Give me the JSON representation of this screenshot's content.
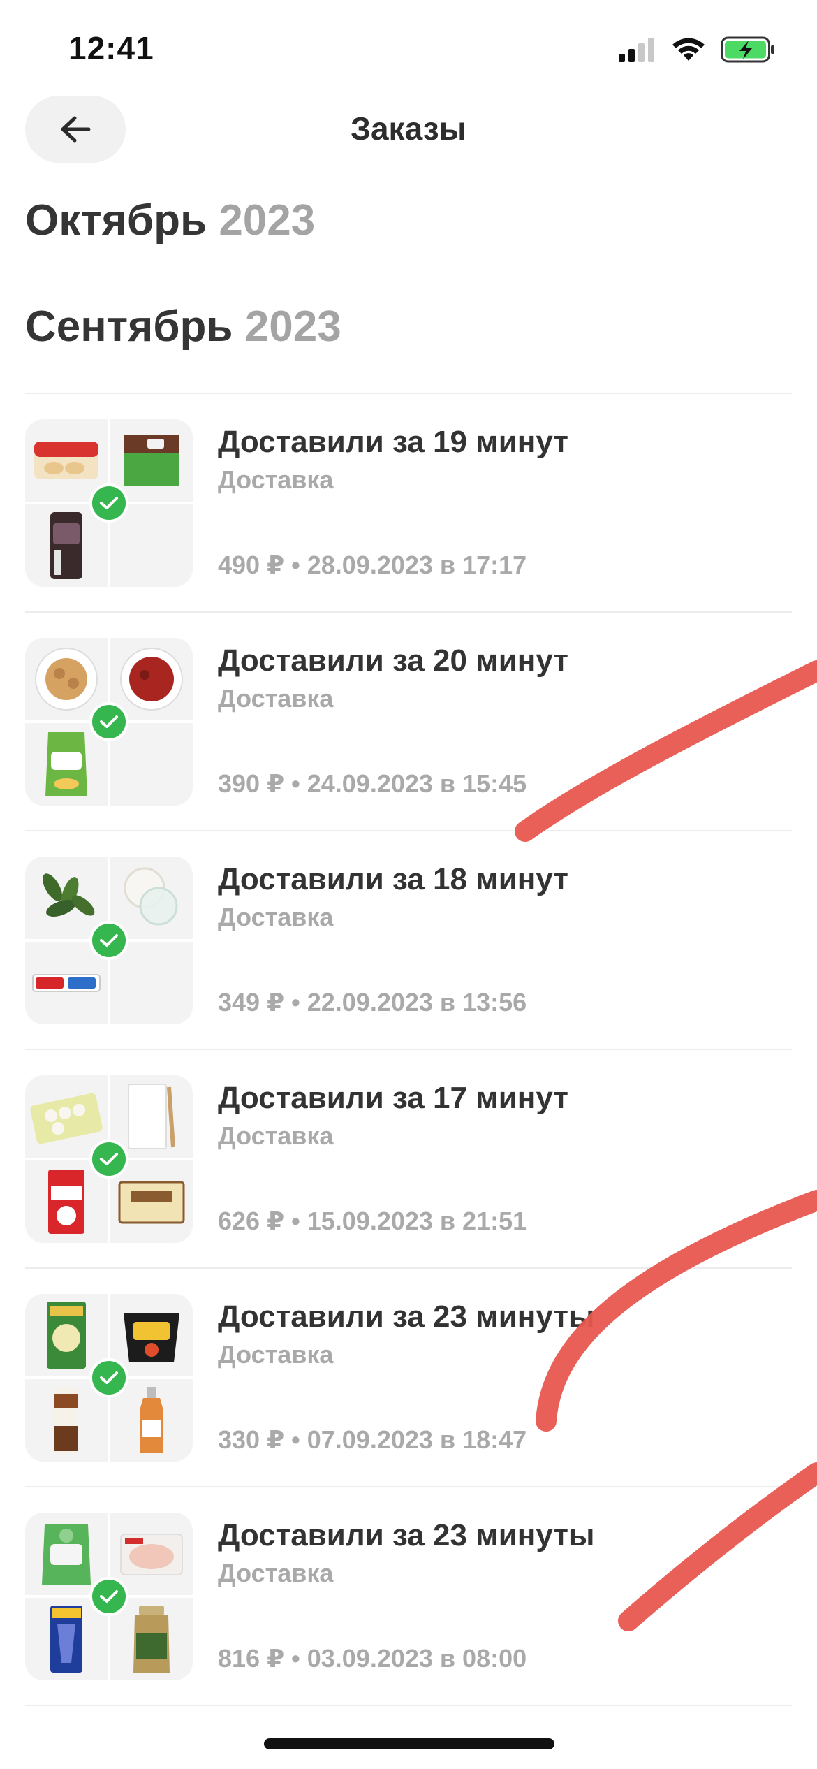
{
  "status_bar": {
    "time": "12:41"
  },
  "header": {
    "title": "Заказы"
  },
  "months": [
    {
      "name": "Октябрь",
      "year": "2023"
    },
    {
      "name": "Сентябрь",
      "year": "2023"
    }
  ],
  "orders": [
    {
      "title": "Доставили за 19 минут",
      "type": "Доставка",
      "price": "490 ₽",
      "date": "28.09.2023 в 17:17",
      "separator": "•"
    },
    {
      "title": "Доставили за 20 минут",
      "type": "Доставка",
      "price": "390 ₽",
      "date": "24.09.2023 в 15:45",
      "separator": "•"
    },
    {
      "title": "Доставили за 18 минут",
      "type": "Доставка",
      "price": "349 ₽",
      "date": "22.09.2023 в 13:56",
      "separator": "•"
    },
    {
      "title": "Доставили за 17 минут",
      "type": "Доставка",
      "price": "626 ₽",
      "date": "15.09.2023 в 21:51",
      "separator": "•"
    },
    {
      "title": "Доставили за 23 минуты",
      "type": "Доставка",
      "price": "330 ₽",
      "date": "07.09.2023 в 18:47",
      "separator": "•"
    },
    {
      "title": "Доставили за 23 минуты",
      "type": "Доставка",
      "price": "816 ₽",
      "date": "03.09.2023 в 08:00",
      "separator": "•"
    }
  ],
  "icons": {
    "back": "arrow-left-icon",
    "check": "check-icon",
    "signal": "cellular-signal-icon",
    "wifi": "wifi-icon",
    "battery": "battery-charging-icon"
  },
  "colors": {
    "check_green": "#35b64e",
    "battery_green": "#4cd964",
    "annotation_red": "#e8574f"
  }
}
